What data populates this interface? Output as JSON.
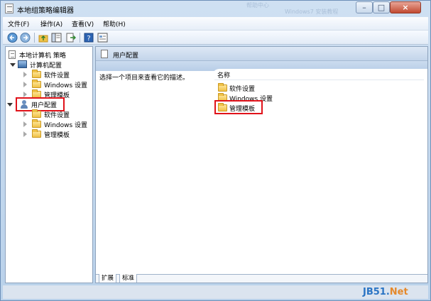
{
  "window": {
    "title": "本地组策略编辑器",
    "bg_ghost_1": "帮助中心",
    "bg_ghost_2": "Windows7 安装教程"
  },
  "menu": [
    {
      "label": "文件(F)"
    },
    {
      "label": "操作(A)"
    },
    {
      "label": "查看(V)"
    },
    {
      "label": "帮助(H)"
    }
  ],
  "toolbar": {
    "buttons": [
      "back-icon",
      "forward-icon",
      "up-folder-icon",
      "show-hide-tree-icon",
      "export-list-icon",
      "help-icon",
      "properties-icon"
    ]
  },
  "tree": {
    "root": "本地计算机 策略",
    "computer_config": "计算机配置",
    "computer_children": [
      "软件设置",
      "Windows 设置",
      "管理模板"
    ],
    "user_config": "用户配置",
    "user_children": [
      "软件设置",
      "Windows 设置",
      "管理模板"
    ]
  },
  "right": {
    "header": "用户配置",
    "description": "选择一个项目来查看它的描述。",
    "column_name": "名称",
    "items": [
      "软件设置",
      "Windows 设置",
      "管理模板"
    ],
    "tabs": [
      "扩展",
      "标准"
    ]
  },
  "watermark": {
    "part1": "JB51.",
    "part2": "Net"
  },
  "colors": {
    "highlight_red": "#e0121a",
    "title_gradient_top": "#cfe0f2",
    "folder_yellow": "#f0c247"
  }
}
